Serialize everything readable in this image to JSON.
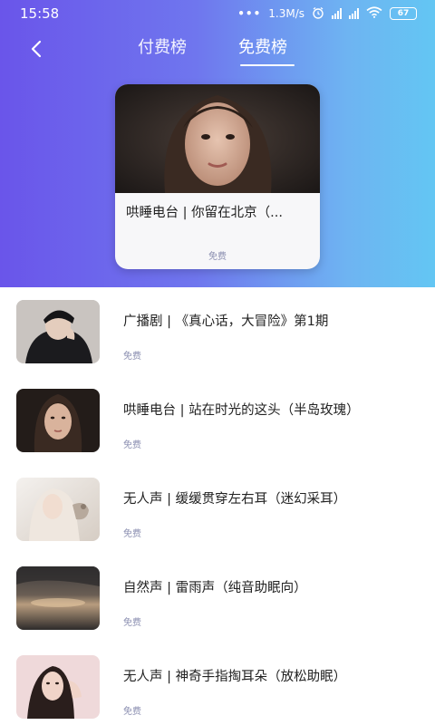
{
  "status_bar": {
    "time": "15:58",
    "network_speed": "1.3M/s",
    "battery": "67"
  },
  "nav": {
    "back_icon": "chevron-left-icon",
    "tabs": [
      {
        "label": "付费榜",
        "active": false
      },
      {
        "label": "免费榜",
        "active": true
      }
    ]
  },
  "featured": {
    "title": "哄睡电台 | 你留在北京（...",
    "price": "免费",
    "image": "portrait-girl"
  },
  "list": [
    {
      "title": "广播剧 | 《真心话，大冒险》第1期",
      "price": "免费",
      "image": "boy-dark"
    },
    {
      "title": "哄睡电台 | 站在时光的这头（半岛玫瑰）",
      "price": "免费",
      "image": "girl-portrait"
    },
    {
      "title": "无人声 | 缓缓贯穿左右耳（迷幻采耳）",
      "price": "免费",
      "image": "pale-girl"
    },
    {
      "title": "自然声 | 雷雨声（纯音助眠向）",
      "price": "免费",
      "image": "storm-sky"
    },
    {
      "title": "无人声 | 神奇手指掏耳朵（放松助眠）",
      "price": "免费",
      "image": "woman-pink"
    }
  ],
  "colors": {
    "gradient_start": "#6a55ea",
    "gradient_end": "#63c6f3",
    "price_text": "#8a8eb0"
  }
}
